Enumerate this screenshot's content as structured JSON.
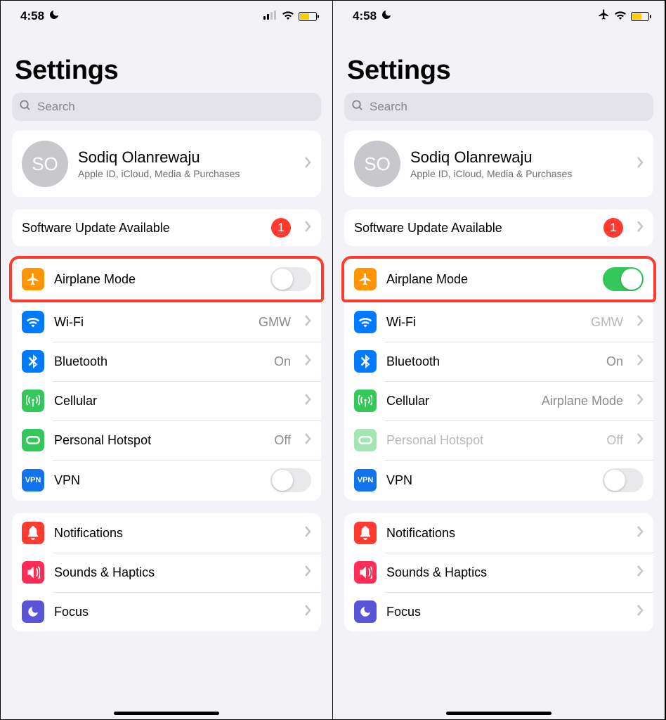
{
  "status": {
    "time": "4:58"
  },
  "title": "Settings",
  "search": {
    "placeholder": "Search"
  },
  "profile": {
    "initials": "SO",
    "name": "Sodiq Olanrewaju",
    "subtitle": "Apple ID, iCloud, Media & Purchases"
  },
  "update": {
    "label": "Software Update Available",
    "badge": "1"
  },
  "left": {
    "airplane": {
      "label": "Airplane Mode",
      "on": false
    },
    "wifi": {
      "label": "Wi-Fi",
      "value": "GMW"
    },
    "bluetooth": {
      "label": "Bluetooth",
      "value": "On"
    },
    "cellular": {
      "label": "Cellular",
      "value": ""
    },
    "hotspot": {
      "label": "Personal Hotspot",
      "value": "Off"
    },
    "vpn": {
      "label": "VPN",
      "on": false
    }
  },
  "right": {
    "airplane": {
      "label": "Airplane Mode",
      "on": true
    },
    "wifi": {
      "label": "Wi-Fi",
      "value": "GMW"
    },
    "bluetooth": {
      "label": "Bluetooth",
      "value": "On"
    },
    "cellular": {
      "label": "Cellular",
      "value": "Airplane Mode"
    },
    "hotspot": {
      "label": "Personal Hotspot",
      "value": "Off"
    },
    "vpn": {
      "label": "VPN",
      "on": false
    }
  },
  "group3": {
    "notifications": "Notifications",
    "sounds": "Sounds & Haptics",
    "focus": "Focus"
  },
  "colors": {
    "badge": "#ff3b30",
    "toggle_on": "#34c759",
    "battery": "#ffcc00"
  }
}
